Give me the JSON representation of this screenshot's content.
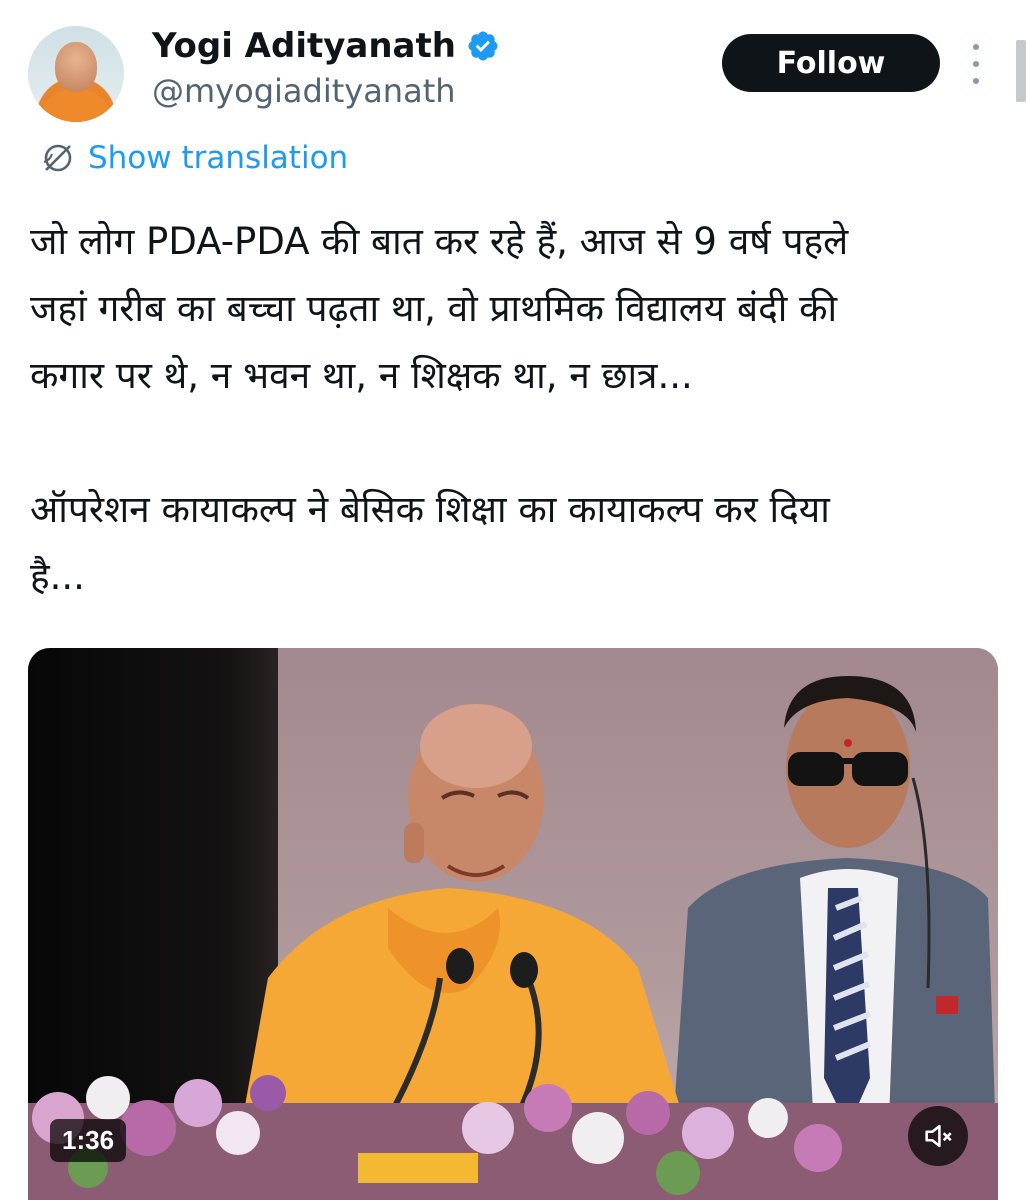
{
  "author": {
    "name": "Yogi Adityanath",
    "handle": "@myogiadityanath",
    "verified_icon": "verified-badge-icon"
  },
  "actions": {
    "follow_label": "Follow",
    "more_icon": "more-vertical-icon"
  },
  "translation": {
    "label": "Show translation",
    "icon": "globe-icon"
  },
  "tweet": {
    "text": "जो लोग PDA-PDA की बात कर रहे हैं, आज से 9 वर्ष पहले\nजहां गरीब का बच्चा पढ़ता था, वो प्राथमिक विद्यालय बंदी की\nकगार पर थे, न भवन था, न शिक्षक था, न छात्र...\n\nऑपरेशन कायाकल्प ने बेसिक शिक्षा का कायाकल्प कर दिया\nहै..."
  },
  "media": {
    "duration": "1:36",
    "mute_icon": "volume-muted-icon"
  },
  "colors": {
    "link": "#1d9bf0",
    "verified": "#1d9bf0",
    "follow_bg": "#0f1419",
    "secondary_text": "#536471"
  }
}
